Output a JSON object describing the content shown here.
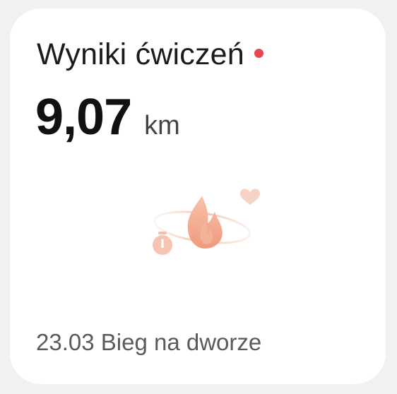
{
  "card": {
    "title": "Wyniki ćwiczeń",
    "value": "9,07",
    "unit": "km",
    "footer": "23.03 Bieg na dworze",
    "indicator_color": "#e5484d",
    "illustration_icons": [
      "flame-icon",
      "stopwatch-icon",
      "heart-icon"
    ],
    "accent_color": "#f1a688"
  }
}
